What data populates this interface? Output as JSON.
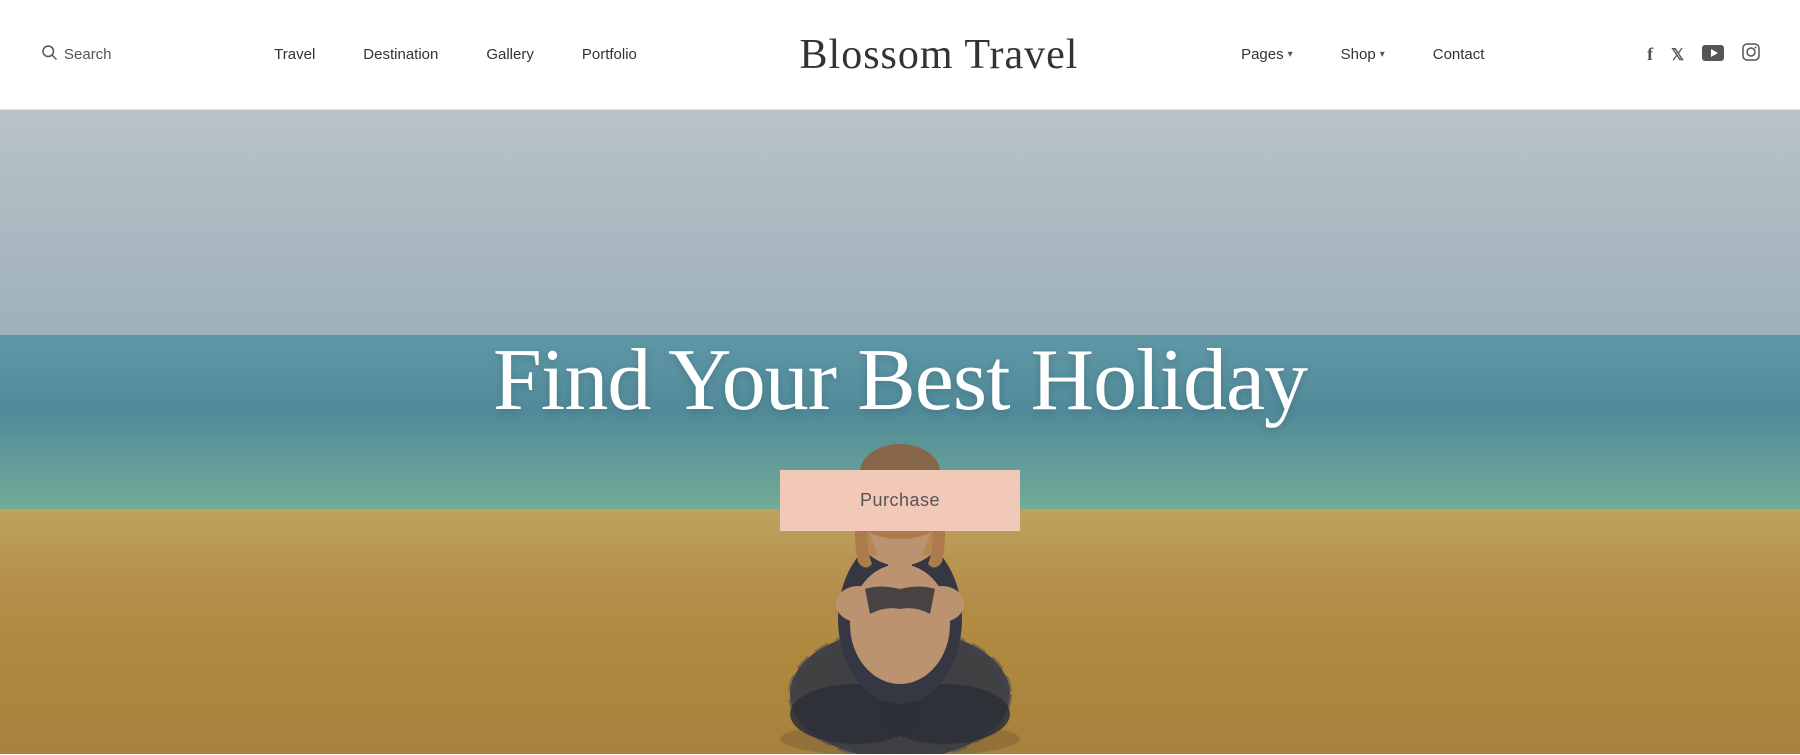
{
  "header": {
    "search_label": "Search",
    "logo_text": "Blossom Travel",
    "nav_left": [
      {
        "id": "travel",
        "label": "Travel",
        "has_dropdown": false
      },
      {
        "id": "destination",
        "label": "Destination",
        "has_dropdown": false
      },
      {
        "id": "gallery",
        "label": "Gallery",
        "has_dropdown": false
      },
      {
        "id": "portfolio",
        "label": "Portfolio",
        "has_dropdown": false
      }
    ],
    "nav_right": [
      {
        "id": "pages",
        "label": "Pages",
        "has_dropdown": true
      },
      {
        "id": "shop",
        "label": "Shop",
        "has_dropdown": true
      },
      {
        "id": "contact",
        "label": "Contact",
        "has_dropdown": false
      }
    ],
    "social": [
      {
        "id": "facebook",
        "label": "f"
      },
      {
        "id": "twitter",
        "label": "𝕏"
      },
      {
        "id": "youtube",
        "label": "▶"
      },
      {
        "id": "instagram",
        "label": "◻"
      }
    ]
  },
  "hero": {
    "title": "Find Your Best Holiday",
    "purchase_label": "Purchase"
  }
}
